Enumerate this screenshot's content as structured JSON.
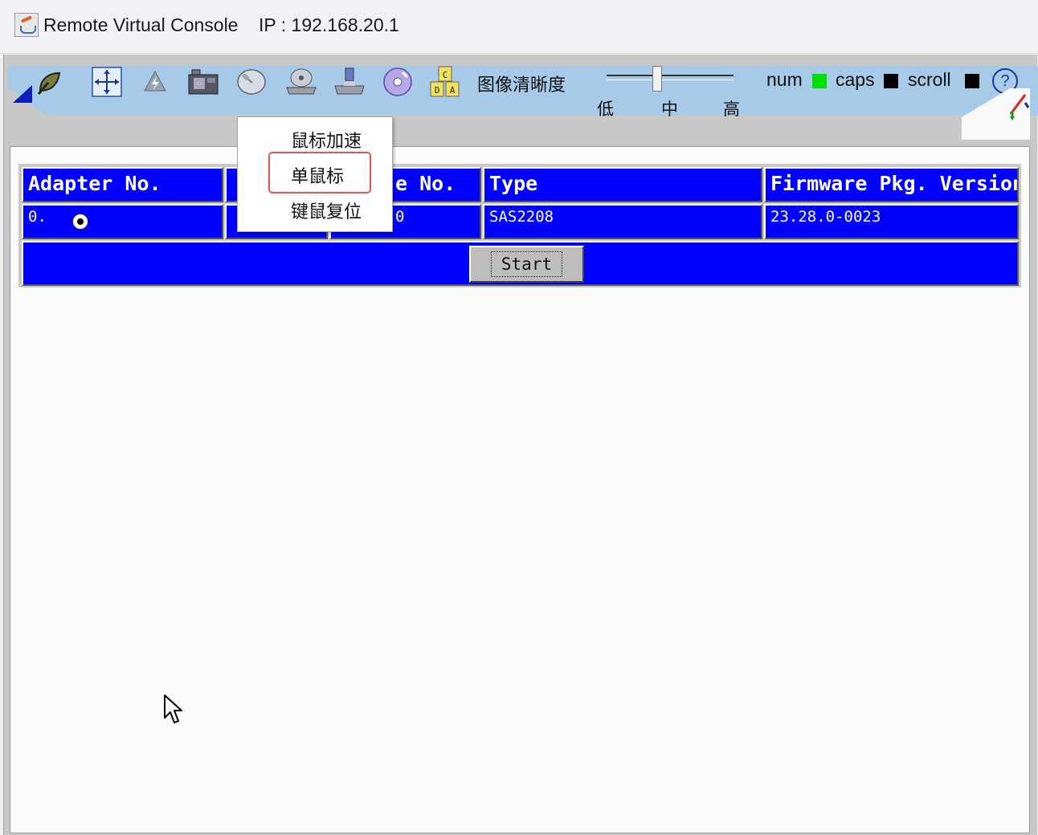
{
  "window": {
    "title": "Remote Virtual Console    IP : 192.168.20.1"
  },
  "toolbar": {
    "icons": [
      "leaf-icon",
      "move-icon",
      "power-icon",
      "film-icon",
      "mouse-icon",
      "disk-drive-icon",
      "floppy-drive-icon",
      "cd-rom-icon",
      "keyboard-keys-icon"
    ],
    "keyboard_keys": [
      "C",
      "D",
      "A"
    ],
    "quality_label": "图像清晰度",
    "quality_levels": [
      "低",
      "中",
      "高"
    ],
    "quality_value": "中",
    "locks": [
      {
        "label": "num",
        "color": "#00e000"
      },
      {
        "label": "caps",
        "color": "#000000"
      },
      {
        "label": "scroll",
        "color": "#000000"
      }
    ],
    "help": "?"
  },
  "mouse_menu": {
    "items": [
      "鼠标加速",
      "单鼠标",
      "键鼠复位"
    ],
    "highlighted": "单鼠标"
  },
  "console_table": {
    "headers": [
      "Adapter No.",
      "",
      "e No.",
      "Type",
      "Firmware Pkg. Version"
    ],
    "row": [
      "0.",
      "",
      "0",
      "SAS2208",
      "23.28.0-0023"
    ],
    "start_label": "Start"
  },
  "colors": {
    "toolbar_bg": "#a7cae8",
    "table_blue": "#0000ff",
    "menu_highlight": "#e8505b"
  }
}
